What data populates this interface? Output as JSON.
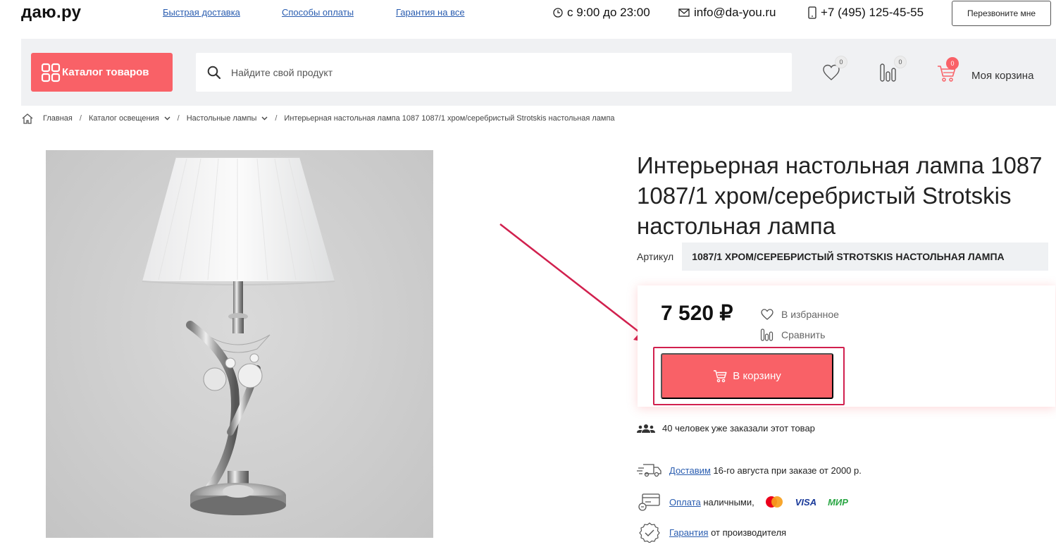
{
  "header": {
    "logo": "даю.ру",
    "links": [
      "Быстрая доставка",
      "Способы оплаты",
      "Гарантия на все"
    ],
    "hours": "с 9:00 до 23:00",
    "email": "info@da-you.ru",
    "phone": "+7 (495) 125-45-55",
    "callback_label": "Перезвоните мне"
  },
  "toolbar": {
    "catalog_label": "Каталог товаров",
    "search_placeholder": "Найдите свой продукт",
    "favorites_count": "0",
    "compare_count": "0",
    "cart_count": "0",
    "cart_label": "Моя корзина"
  },
  "breadcrumb": {
    "items": [
      "Главная",
      "Каталог освещения",
      "Настольные лампы",
      "Интерьерная настольная лампа 1087 1087/1 хром/серебристый Strotskis настольная лампа"
    ]
  },
  "product": {
    "title": "Интерьерная настольная лампа 1087 1087/1 хром/серебристый Strotskis настольная лампа",
    "sku_label": "Артикул",
    "sku_value": "1087/1 ХРОМ/СЕРЕБРИСТЫЙ STROTSKIS НАСТОЛЬНАЯ ЛАМПА",
    "price": "7 520 ₽",
    "favorite_label": "В избранное",
    "compare_label": "Сравнить",
    "add_to_cart_label": "В корзину",
    "orders_text": "40 человек уже заказали этот товар",
    "delivery_link": "Доставим",
    "delivery_text": "16-го августа при заказе от 2000 р.",
    "payment_link": "Оплата",
    "payment_text": "наличными,",
    "payment_visa": "VISA",
    "payment_mir": "МИР",
    "warranty_link": "Гарантия",
    "warranty_text": "от производителя"
  },
  "colors": {
    "accent": "#f96167",
    "highlight_frame": "#d1204e",
    "link": "#2a5db0"
  },
  "icons": [
    "clock-icon",
    "mail-icon",
    "phone-icon",
    "grid-icon",
    "search-icon",
    "heart-icon",
    "compare-icon",
    "cart-icon",
    "home-icon",
    "users-icon",
    "truck-icon",
    "card-icon",
    "shield-check-icon",
    "mastercard-icon"
  ]
}
